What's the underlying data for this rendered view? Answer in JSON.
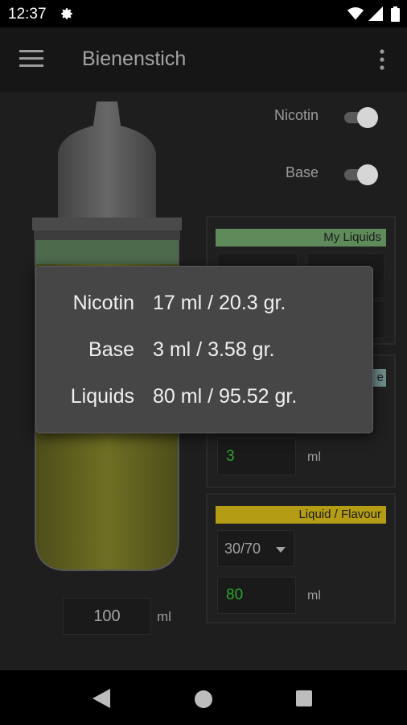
{
  "status_bar": {
    "time": "12:37"
  },
  "app_bar": {
    "title": "Bienenstich"
  },
  "toggles": [
    {
      "label": "Nicotin",
      "on": true
    },
    {
      "label": "Base",
      "on": true
    }
  ],
  "panels": {
    "my_liquids": {
      "header": "My Liquids",
      "header_color": "#5f8a5a"
    },
    "base": {
      "header_partial": "e",
      "header_color": "#6e8c8a",
      "value": "3",
      "unit": "ml"
    },
    "flavour": {
      "header": "Liquid / Flavour",
      "header_color": "#b49c14",
      "ratio": "30/70",
      "value": "80",
      "unit": "ml"
    }
  },
  "volume": {
    "value": "100",
    "unit": "ml"
  },
  "popup": {
    "rows": [
      {
        "label": "Nicotin",
        "value": "17 ml / 20.3 gr."
      },
      {
        "label": "Base",
        "value": "3 ml / 3.58 gr."
      },
      {
        "label": "Liquids",
        "value": "80 ml / 95.52 gr."
      }
    ]
  },
  "colors": {
    "green_value": "#2aa52a",
    "liquid": "#6b6b22",
    "band": "#4d6a4d"
  }
}
